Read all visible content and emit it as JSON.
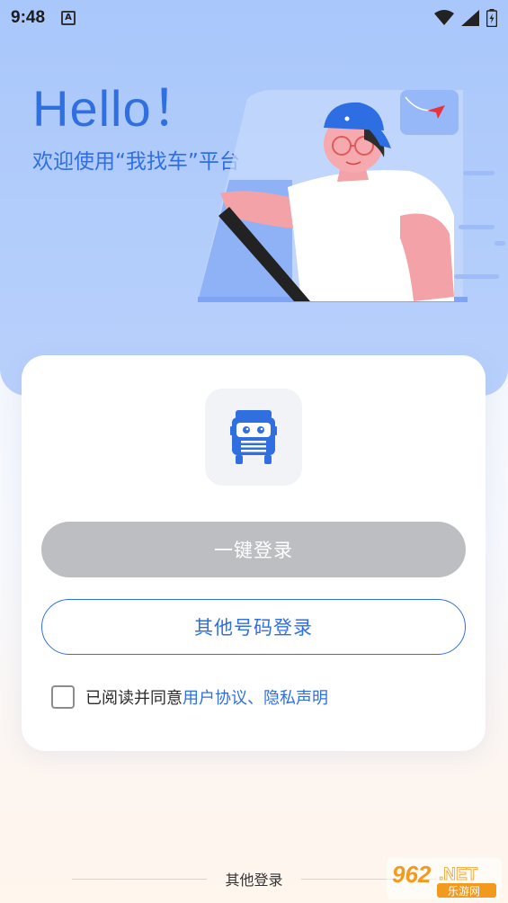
{
  "status_bar": {
    "time": "9:48",
    "a_icon": "A"
  },
  "header": {
    "greeting": "Hello！",
    "welcome": "欢迎使用“我找车”平台"
  },
  "login": {
    "one_click_label": "一键登录",
    "other_number_label": "其他号码登录",
    "agreement_prefix": "已阅读并同意",
    "agreement_links": "用户协议、隐私声明"
  },
  "footer": {
    "other_login": "其他登录"
  },
  "watermark": {
    "number": "962",
    "suffix": ".NET",
    "sub": "乐游网"
  },
  "colors": {
    "accent": "#2f6fe0",
    "disabled_button": "#bdbec2",
    "hero_bg": "#aecafb"
  },
  "icons": [
    "signal-icon",
    "wifi-icon",
    "battery-icon",
    "truck-logo-icon",
    "paper-plane-icon"
  ]
}
